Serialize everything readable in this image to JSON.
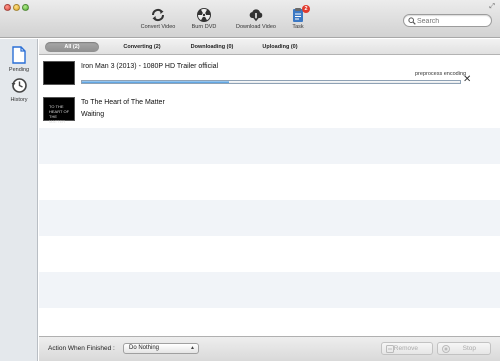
{
  "toolbar": {
    "buttons": [
      {
        "label": "Convert Video",
        "icon": "convert-icon"
      },
      {
        "label": "Burn DVD",
        "icon": "burn-icon"
      },
      {
        "label": "Download Video",
        "icon": "download-cloud-icon"
      },
      {
        "label": "Task",
        "icon": "task-icon",
        "badge": "2"
      }
    ],
    "search": {
      "placeholder": "Search",
      "value": ""
    }
  },
  "sidebar": {
    "items": [
      {
        "label": "Pending",
        "icon": "document-icon"
      },
      {
        "label": "History",
        "icon": "history-icon"
      }
    ]
  },
  "tabs": [
    {
      "label": "All (2)",
      "active": true
    },
    {
      "label": "Converting (2)",
      "active": false
    },
    {
      "label": "Downloading (0)",
      "active": false
    },
    {
      "label": "Uploading (0)",
      "active": false
    }
  ],
  "tasks": [
    {
      "title": "Iron Man 3 (2013) - 1080P HD Trailer official",
      "status": "preprocess encoding",
      "progress": 0.39
    },
    {
      "title": "To The Heart of The Matter",
      "status": "Waiting",
      "thumb_text": "TO THE\nHEART OF\nTHE MATTER"
    }
  ],
  "footer": {
    "action_label": "Action When Finished :",
    "action_value": "Do Nothing",
    "remove_label": "Remove",
    "stop_label": "Stop"
  },
  "colors": {
    "progress_fill": "#4a98db",
    "badge": "#e23b2e",
    "sidebar_accent": "#2a6fd6"
  }
}
